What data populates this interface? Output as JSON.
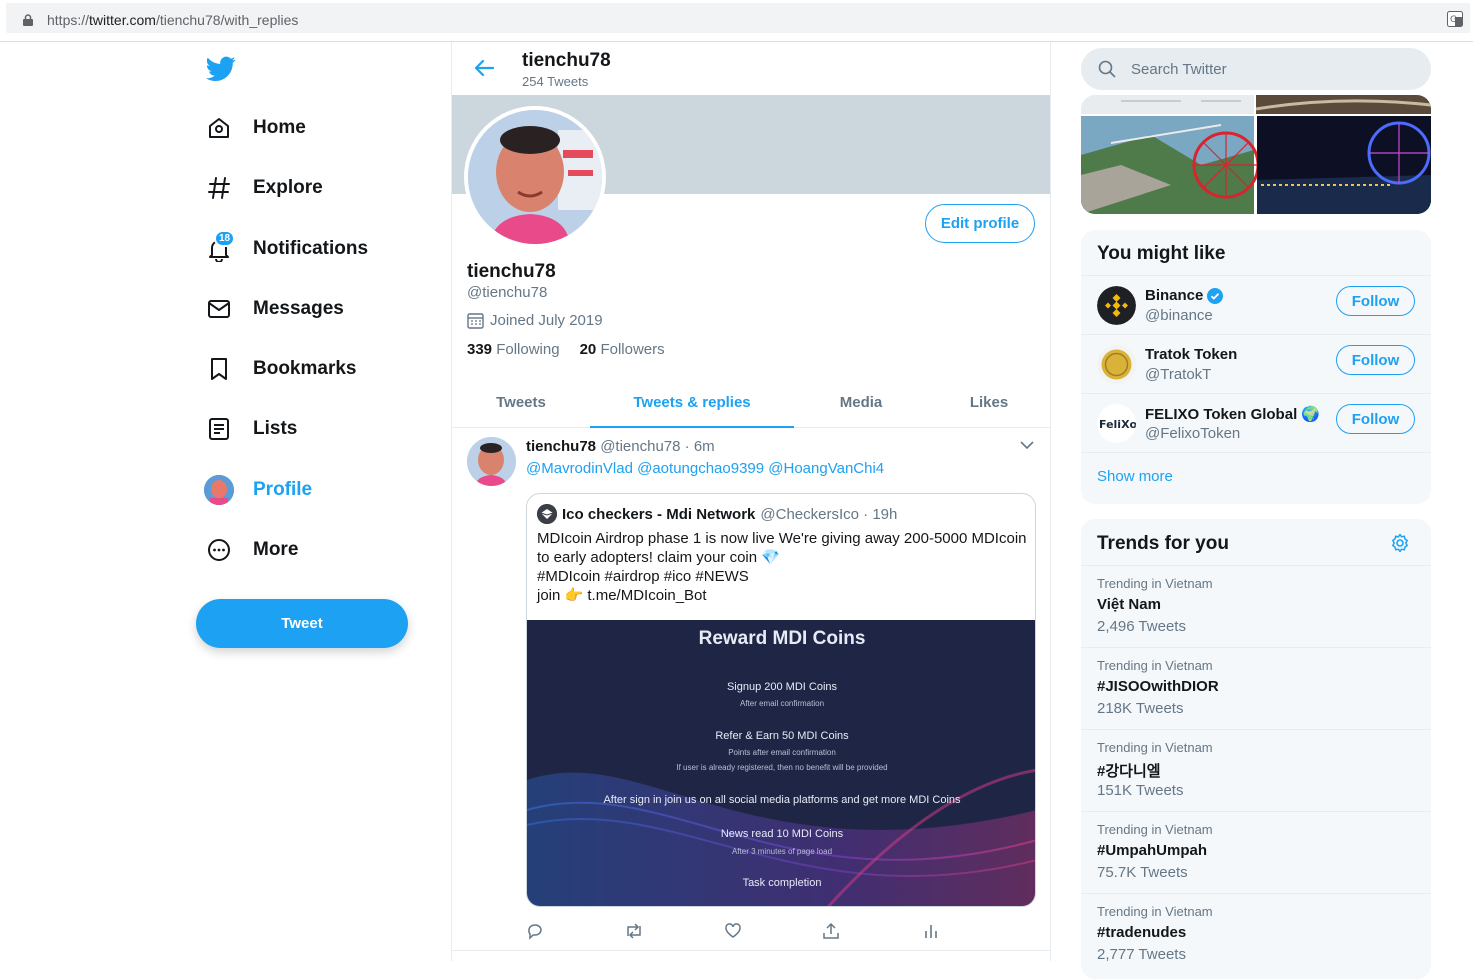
{
  "browser": {
    "url_scheme": "https://",
    "url_host": "twitter.com",
    "url_path": "/tienchu78/with_replies"
  },
  "nav": {
    "items": [
      {
        "label": "Home",
        "icon": "home-icon"
      },
      {
        "label": "Explore",
        "icon": "hashtag-icon"
      },
      {
        "label": "Notifications",
        "icon": "bell-icon",
        "badge": "18"
      },
      {
        "label": "Messages",
        "icon": "envelope-icon"
      },
      {
        "label": "Bookmarks",
        "icon": "bookmark-icon"
      },
      {
        "label": "Lists",
        "icon": "list-icon"
      },
      {
        "label": "Profile",
        "icon": "avatar",
        "active": true
      },
      {
        "label": "More",
        "icon": "more-icon"
      }
    ],
    "tweet_button": "Tweet"
  },
  "header": {
    "name": "tienchu78",
    "tweet_count": "254 Tweets"
  },
  "profile": {
    "edit_button": "Edit profile",
    "name": "tienchu78",
    "handle": "@tienchu78",
    "joined": "Joined July 2019",
    "following_count": "339",
    "following_label": "Following",
    "followers_count": "20",
    "followers_label": "Followers"
  },
  "tabs": [
    {
      "label": "Tweets"
    },
    {
      "label": "Tweets & replies",
      "active": true
    },
    {
      "label": "Media"
    },
    {
      "label": "Likes"
    }
  ],
  "tweet": {
    "name": "tienchu78",
    "meta": "@tienchu78 · 6m",
    "mentions": "@MavrodinVlad @aotungchao9399 @HoangVanChi4",
    "quote": {
      "name": "Ico checkers - Mdi Network",
      "meta": "@CheckersIco · 19h",
      "text": "MDIcoin Airdrop phase 1 is now live We're giving away 200-5000 MDIcoin to early adopters! claim your coin 💎\n#MDIcoin #airdrop #ico #NEWS\njoin 👉 t.me/MDIcoin_Bot",
      "image": {
        "title": "Reward MDI Coins",
        "line1": "Signup 200 MDI Coins",
        "line1_sub": "After email confirmation",
        "line2": "Refer & Earn 50 MDI Coins",
        "line2_sub": "Points after email confirmation",
        "line2_sub2": "If user is already registered, then no benefit will be provided",
        "line3": "After sign in join us on all social media platforms and get more MDI Coins",
        "line4": "News read 10 MDI Coins",
        "line4_sub": "After 3 minutes of page load",
        "line5": "Task completion"
      }
    }
  },
  "search": {
    "placeholder": "Search Twitter"
  },
  "you_might_like": {
    "title": "You might like",
    "accounts": [
      {
        "name": "Binance",
        "handle": "@binance",
        "verified": true,
        "follow": "Follow"
      },
      {
        "name": "Tratok Token",
        "handle": "@TratokT",
        "follow": "Follow"
      },
      {
        "name": "FELIXO Token Global",
        "handle": "@FelixoToken",
        "emoji": "🌍",
        "follow": "Follow",
        "logo_text": "FeliXo"
      }
    ],
    "show_more": "Show more"
  },
  "trends": {
    "title": "Trends for you",
    "items": [
      {
        "context": "Trending in Vietnam",
        "name": "Việt Nam",
        "count": "2,496 Tweets"
      },
      {
        "context": "Trending in Vietnam",
        "name": "#JISOOwithDIOR",
        "count": "218K Tweets"
      },
      {
        "context": "Trending in Vietnam",
        "name": "#강다니엘",
        "count": "151K Tweets"
      },
      {
        "context": "Trending in Vietnam",
        "name": "#UmpahUmpah",
        "count": "75.7K Tweets"
      },
      {
        "context": "Trending in Vietnam",
        "name": "#tradenudes",
        "count": "2,777 Tweets"
      }
    ]
  },
  "colors": {
    "accent": "#1da1f2",
    "text": "#14171a",
    "muted": "#657786",
    "banner": "#ccd6dd"
  }
}
